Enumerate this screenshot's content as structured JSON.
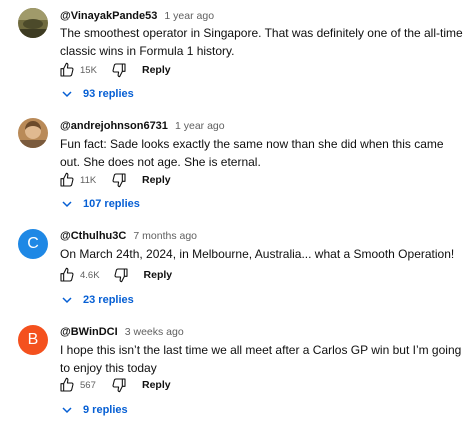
{
  "labels": {
    "reply": "Reply"
  },
  "colors": {
    "link_blue": "#065fd4",
    "meta_gray": "#606060",
    "avatar_c": "#1e88e5",
    "avatar_b": "#f4511e"
  },
  "comments": [
    {
      "author": "@VinayakPande53",
      "time": "1 year ago",
      "text": "The smoothest operator in Singapore. That was definitely one of the all-time classic wins in Formula 1 history.",
      "likes": "15K",
      "replies": "93 replies",
      "avatar": "photo-olive"
    },
    {
      "author": "@andrejohnson6731",
      "time": "1 year ago",
      "text": "Fun fact: Sade looks exactly the same now than she did when this came out. She does not age. She is eternal.",
      "likes": "11K",
      "replies": "107 replies",
      "avatar": "photo-portrait"
    },
    {
      "author": "@Cthulhu3C",
      "time": "7 months ago",
      "text": "On March 24th, 2024, in Melbourne, Australia... what a Smooth Operation!",
      "likes": "4.6K",
      "replies": "23 replies",
      "avatar_letter": "C"
    },
    {
      "author": "@BWinDCI",
      "time": "3 weeks ago",
      "text": "I hope this isn’t the last time we all meet after a Carlos GP win but I’m going to enjoy this today",
      "likes": "567",
      "replies": "9 replies",
      "avatar_letter": "B"
    }
  ]
}
